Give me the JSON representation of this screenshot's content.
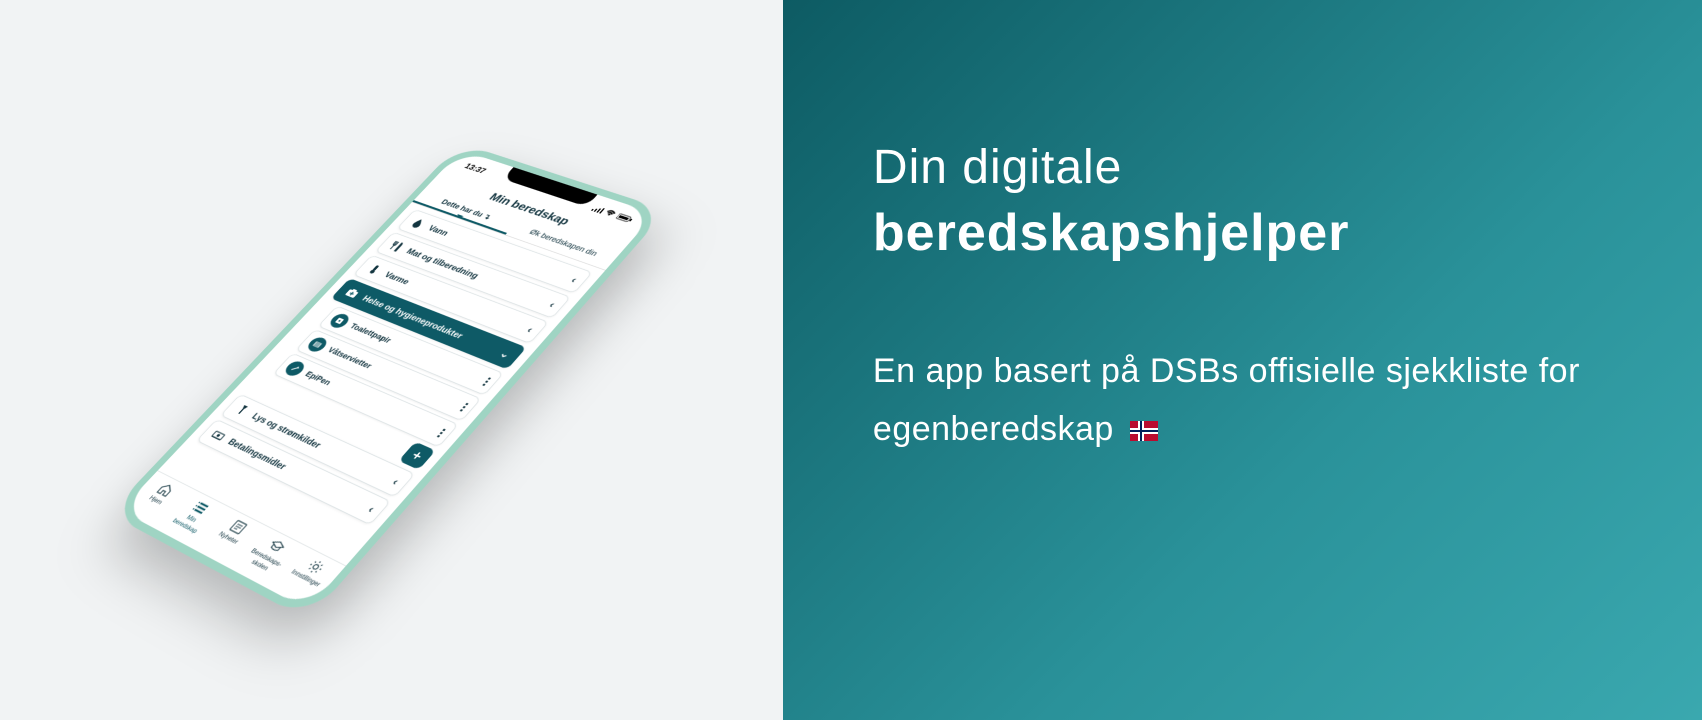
{
  "marketing": {
    "heading_light": "Din digitale",
    "heading_bold": "beredskapshjelper",
    "subtext": "En app basert på DSBs offisielle sjekkliste for egenberedskap"
  },
  "phone": {
    "status_time": "13:37",
    "app_title": "Min beredskap",
    "tabs": {
      "have": "Dette har du ↴",
      "increase": "Øk beredskapen din"
    },
    "categories": {
      "water": "Vann",
      "food": "Mat og tilberedning",
      "heat": "Varme",
      "health": "Helse og hygieneprodukter",
      "light": "Lys og strømkilder",
      "payment": "Betalingsmidler"
    },
    "sub_items": {
      "toilet_paper": "Toalettpapir",
      "wet_wipes": "Våtservietter",
      "epipen": "EpiPen"
    },
    "nav": {
      "home": "Hjem",
      "my_prep_line1": "Min",
      "my_prep_line2": "beredskap",
      "news": "Nyheter",
      "school_line1": "Beredskaps-",
      "school_line2": "skolen",
      "settings": "Innstillinger"
    }
  }
}
